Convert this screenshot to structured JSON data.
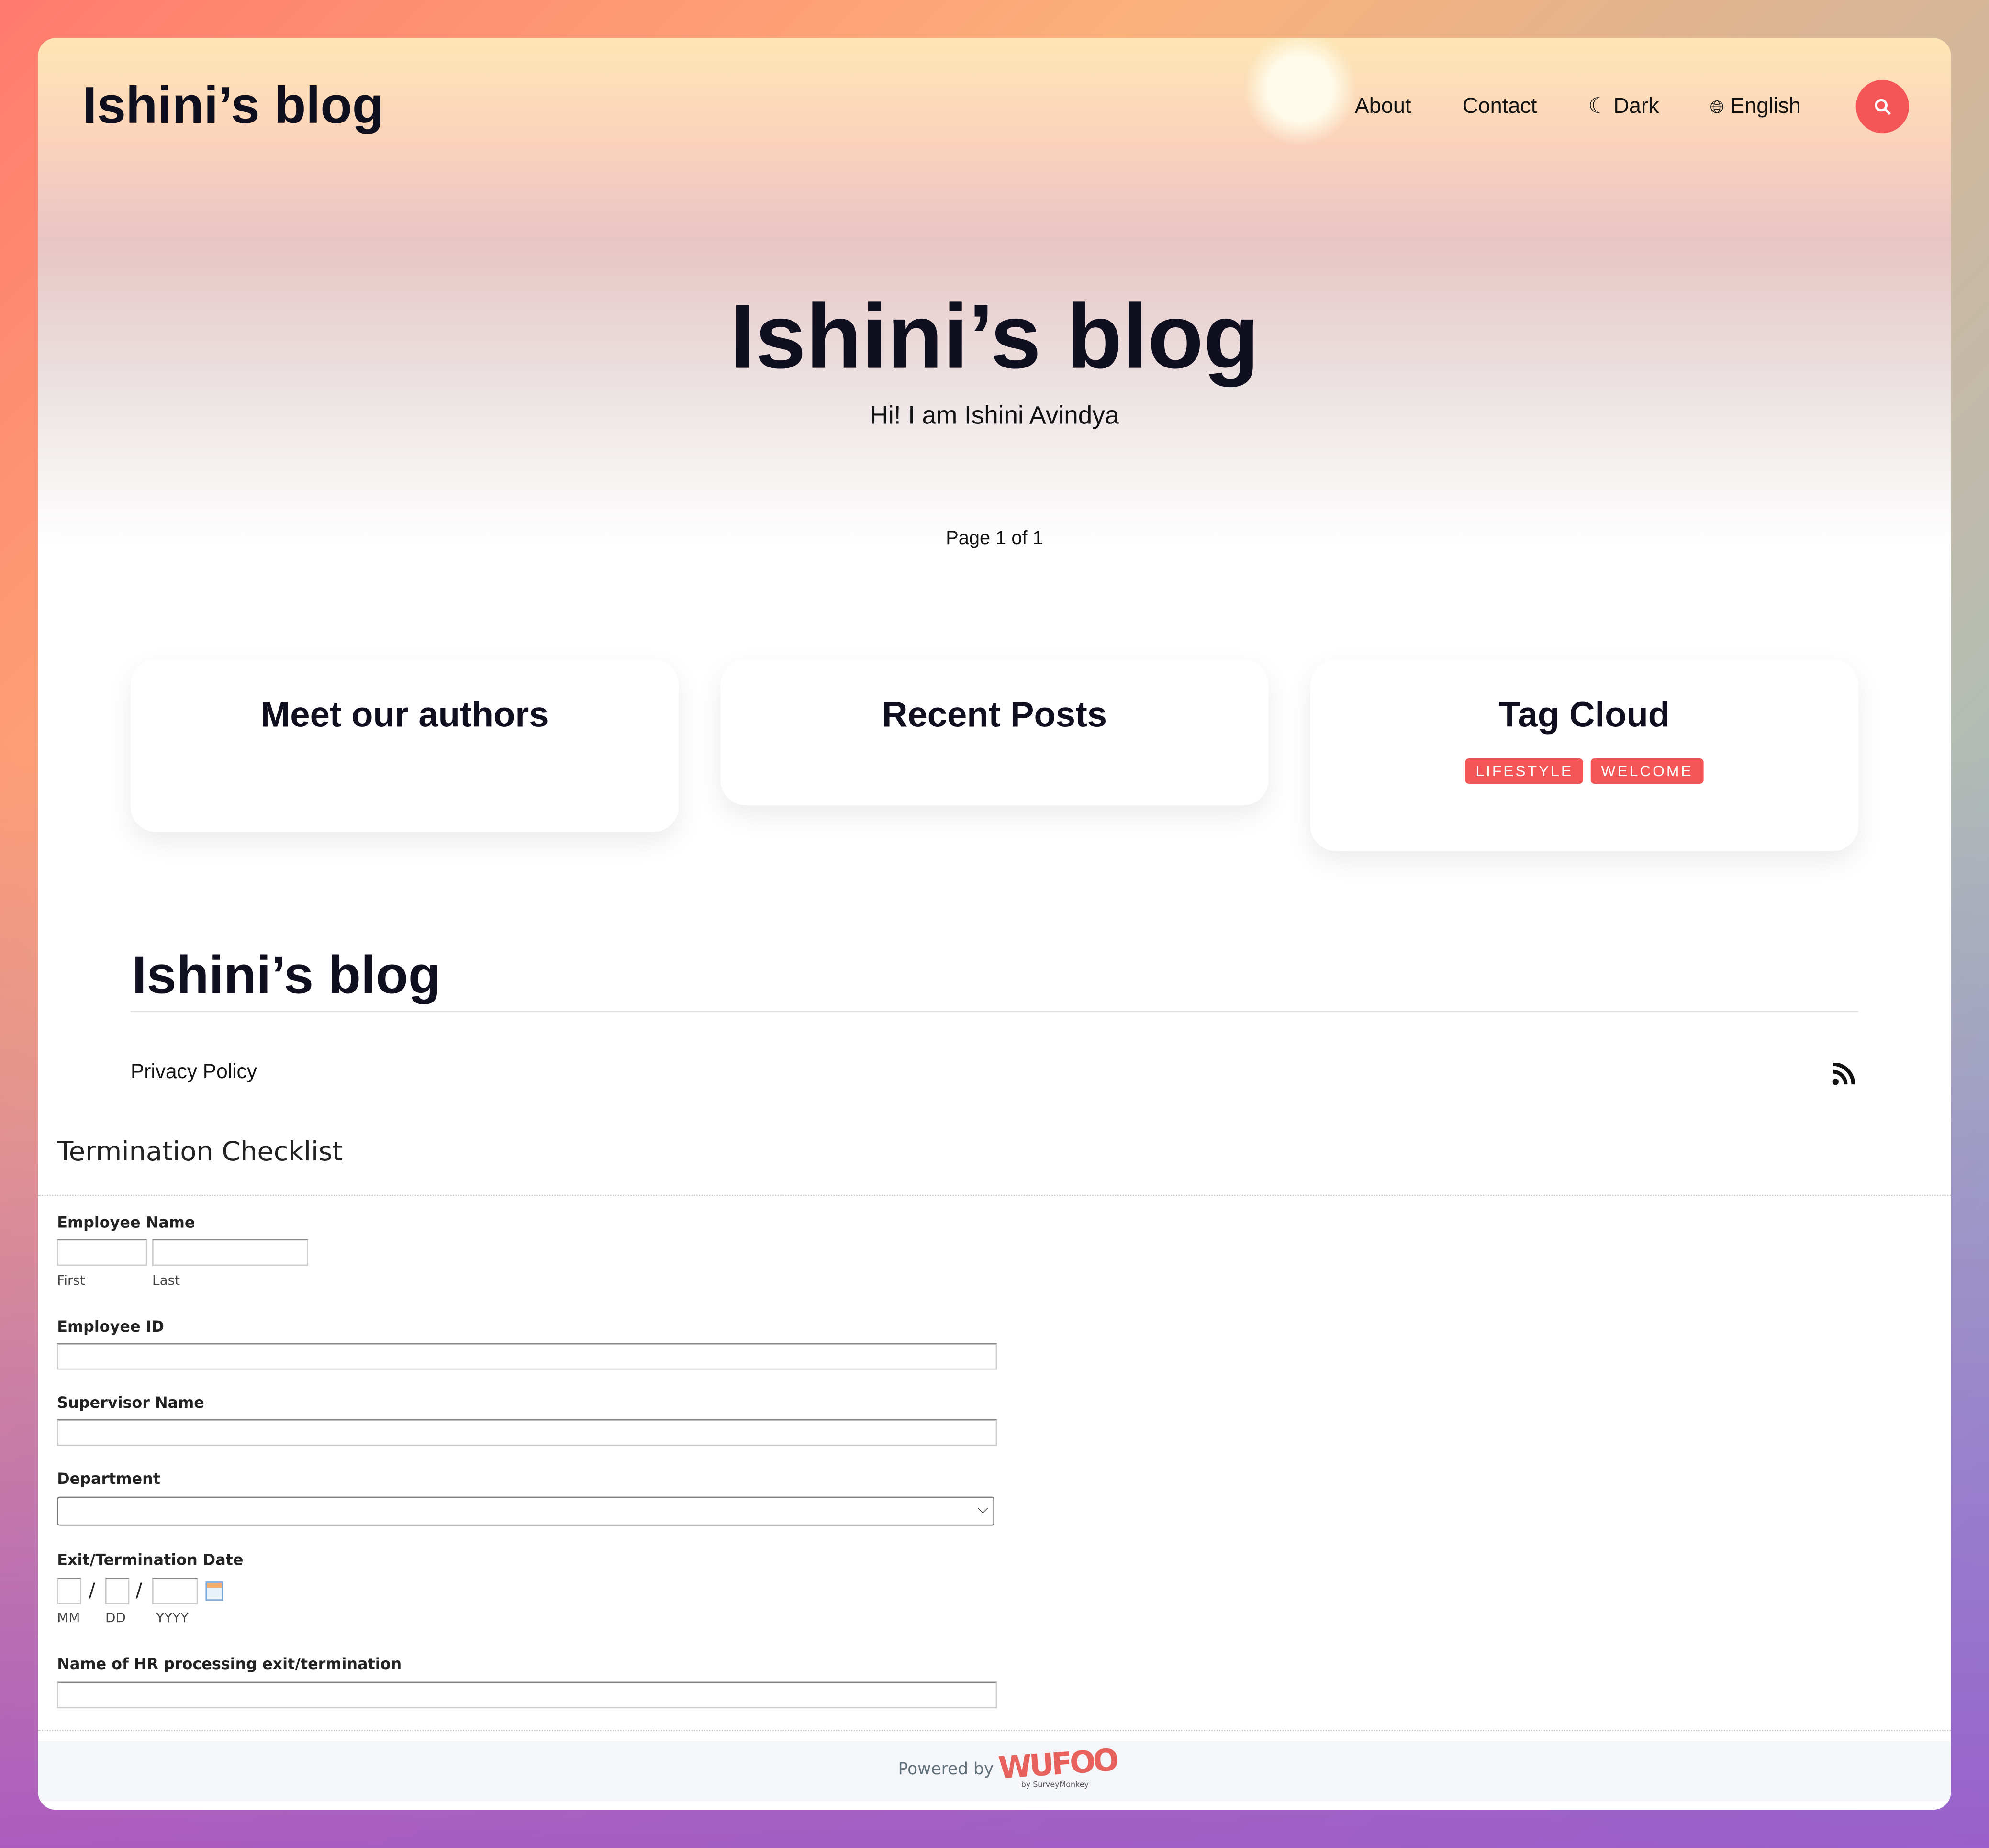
{
  "header": {
    "logo": "Ishini’s blog",
    "nav": [
      {
        "label": "About",
        "icon": ""
      },
      {
        "label": "Contact",
        "icon": ""
      },
      {
        "label": "Dark",
        "icon": "moon-icon"
      },
      {
        "label": "English",
        "icon": "globe-icon"
      }
    ],
    "search_icon": "search-icon",
    "accent": "#f45556"
  },
  "hero": {
    "title": "Ishini’s blog",
    "subtitle": "Hi! I am Ishini Avindya",
    "pagination": "Page 1 of 1"
  },
  "widgets": {
    "authors": "Meet our authors",
    "recent": "Recent Posts",
    "tags_title": "Tag Cloud",
    "tags": [
      "LIFESTYLE",
      "WELCOME"
    ]
  },
  "footer": {
    "title": "Ishini’s blog",
    "privacy": "Privacy Policy",
    "rss_icon": "rss-icon"
  },
  "form": {
    "title": "Termination Checklist",
    "employee_name": {
      "label": "Employee Name",
      "first": "First",
      "last": "Last"
    },
    "employee_id": {
      "label": "Employee ID",
      "value": ""
    },
    "supervisor": {
      "label": "Supervisor Name",
      "value": ""
    },
    "department": {
      "label": "Department",
      "value": ""
    },
    "date": {
      "label": "Exit/Termination Date",
      "mm": "MM",
      "dd": "DD",
      "yyyy": "YYYY",
      "sep": "/"
    },
    "hr": {
      "label": "Name of HR processing exit/termination",
      "value": ""
    },
    "powered": "Powered by",
    "brand": "WUFOO",
    "brand_sub": "by SurveyMonkey",
    "brand_color": "#e8625d"
  }
}
